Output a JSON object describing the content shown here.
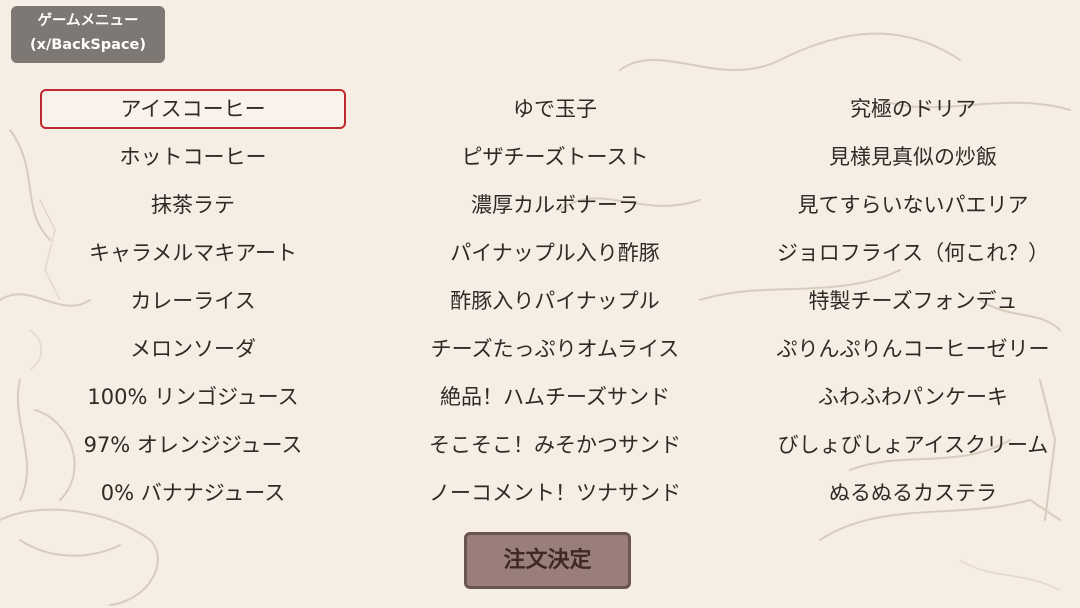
{
  "game_menu": {
    "line1": "ゲームメニュー",
    "line2": "(x/BackSpace)"
  },
  "menu": {
    "selected": "アイスコーヒー",
    "columns": [
      [
        "アイスコーヒー",
        "ホットコーヒー",
        "抹茶ラテ",
        "キャラメルマキアート",
        "カレーライス",
        "メロンソーダ",
        "100% リンゴジュース",
        "97% オレンジジュース",
        "0% バナナジュース"
      ],
      [
        "ゆで玉子",
        "ピザチーズトースト",
        "濃厚カルボナーラ",
        "パイナップル入り酢豚",
        "酢豚入りパイナップル",
        "チーズたっぷりオムライス",
        "絶品！ハムチーズサンド",
        "そこそこ！みそかつサンド",
        "ノーコメント！ツナサンド"
      ],
      [
        "究極のドリア",
        "見様見真似の炒飯",
        "見てすらいないパエリア",
        "ジョロフライス（何これ？）",
        "特製チーズフォンデュ",
        "ぷりんぷりんコーヒーゼリー",
        "ふわふわパンケーキ",
        "びしょびしょアイスクリーム",
        "ぬるぬるカステラ"
      ]
    ]
  },
  "order_button": {
    "label": "注文決定"
  },
  "colors": {
    "background": "#f6eee4",
    "selected_border": "#c0282f",
    "menu_button_bg": "#7e7874",
    "order_button_bg": "#9a7e7c"
  }
}
